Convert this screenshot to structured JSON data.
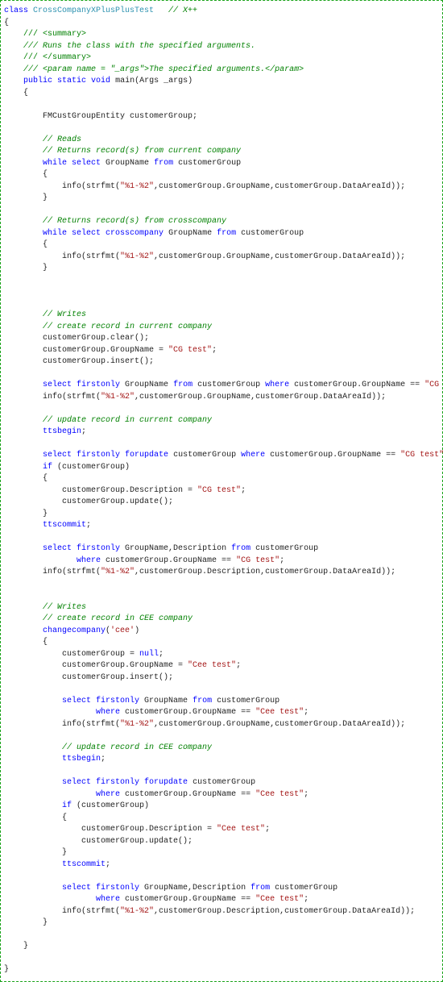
{
  "code": {
    "l1": {
      "k1": "class",
      "type": " CrossCompanyXPlusPlusTest",
      "cmt": "   // X++"
    },
    "brace_open": "{",
    "brace_close": "}",
    "xml": {
      "s1": "/// <summary>",
      "s2": "/// Runs the class with the specified arguments.",
      "s3": "/// </summary>",
      "s4": "/// <param name = \"_args\">The specified arguments.</param>"
    },
    "sig": {
      "k_public": "public",
      "k_static": " static ",
      "k_void": "void",
      "rest": " main(Args _args)"
    },
    "decl": "        FMCustGroupEntity customerGroup;",
    "reads_hdr": "        // Reads",
    "reads_sub": "        // Returns record(s) from current company",
    "while1": {
      "k1": "while",
      "k2": " select ",
      "rest": "GroupName ",
      "k3": "from",
      "rest2": " customerGroup"
    },
    "info1": {
      "pre": "            info(strfmt(",
      "s": "\"%1-%2\"",
      "post": ",customerGroup.GroupName,customerGroup.DataAreaId));"
    },
    "xc_hdr": "        // Returns record(s) from crosscompany",
    "while2": {
      "k1": "while",
      "k2": " select ",
      "k2b": "crosscompany ",
      "rest": "GroupName ",
      "k3": "from",
      "rest2": " customerGroup"
    },
    "writes_hdr": "        // Writes",
    "writes_sub": "        // create record in current company",
    "clr": "        customerGroup.clear();",
    "setname": {
      "pre": "        customerGroup.GroupName = ",
      "s": "\"CG test\"",
      "post": ";"
    },
    "ins": "        customerGroup.insert();",
    "sel1": {
      "k1": "select",
      "k2": " firstonly ",
      "mid": "GroupName ",
      "k3": "from",
      "mid2": " customerGroup ",
      "k4": "where",
      "mid3": " customerGroup.GroupName == ",
      "s": "\"CG test\"",
      "post": ";"
    },
    "info2": {
      "pre": "        info(strfmt(",
      "s": "\"%1-%2\"",
      "post": ",customerGroup.GroupName,customerGroup.DataAreaId));"
    },
    "upd_hdr": "        // update record in current company",
    "ttsb": "ttsbegin",
    "ttsc": "ttscommit",
    "sel2": {
      "k1": "select",
      "k2": " firstonly ",
      "k2b": "forupdate",
      "mid": " customerGroup ",
      "k3": "where",
      "mid2": " customerGroup.GroupName == ",
      "s": "\"CG test\"",
      "post": ";"
    },
    "ifcg": {
      "k": "if",
      "rest": " (customerGroup)"
    },
    "setdesc": {
      "pre": "            customerGroup.Description = ",
      "s": "\"CG test\"",
      "post": ";"
    },
    "upd": "            customerGroup.update();",
    "sel3": {
      "k1": "select",
      "k2": " firstonly ",
      "mid": "GroupName,Description ",
      "k3": "from",
      "mid2": " customerGroup"
    },
    "sel3b": {
      "k": "where",
      "mid": " customerGroup.GroupName == ",
      "s": "\"CG test\"",
      "post": ";"
    },
    "info3": {
      "pre": "        info(strfmt(",
      "s": "\"%1-%2\"",
      "post": ",customerGroup.Description,customerGroup.DataAreaId));"
    },
    "cee_hdr": "        // create record in CEE company",
    "cc": {
      "k": "changecompany",
      "pre": "(",
      "s": "'cee'",
      "post": ")"
    },
    "cgnull": {
      "pre": "            customerGroup = ",
      "k": "null",
      "post": ";"
    },
    "setname2": {
      "pre": "            customerGroup.GroupName = ",
      "s": "\"Cee test\"",
      "post": ";"
    },
    "ins2": "            customerGroup.insert();",
    "sel4": {
      "k1": "select",
      "k2": " firstonly ",
      "mid": "GroupName ",
      "k3": "from",
      "mid2": " customerGroup"
    },
    "sel4b": {
      "k": "where",
      "mid": " customerGroup.GroupName == ",
      "s": "\"Cee test\"",
      "post": ";"
    },
    "info4": {
      "pre": "            info(strfmt(",
      "s": "\"%1-%2\"",
      "post": ",customerGroup.GroupName,customerGroup.DataAreaId));"
    },
    "upd_hdr2": "            // update record in CEE company",
    "sel5": {
      "k1": "select",
      "k2": " firstonly ",
      "k2b": "forupdate",
      "mid": " customerGroup"
    },
    "sel5b": {
      "k": "where",
      "mid": " customerGroup.GroupName == ",
      "s": "\"Cee test\"",
      "post": ";"
    },
    "setdesc2": {
      "pre": "                customerGroup.Description = ",
      "s": "\"Cee test\"",
      "post": ";"
    },
    "upd2": "                customerGroup.update();",
    "sel6": {
      "k1": "select",
      "k2": " firstonly ",
      "mid": "GroupName,Description ",
      "k3": "from",
      "mid2": " customerGroup"
    },
    "sel6b": {
      "k": "where",
      "mid": " customerGroup.GroupName == ",
      "s": "\"Cee test\"",
      "post": ";"
    },
    "info5": {
      "pre": "            info(strfmt(",
      "s": "\"%1-%2\"",
      "post": ",customerGroup.Description,customerGroup.DataAreaId));"
    }
  }
}
